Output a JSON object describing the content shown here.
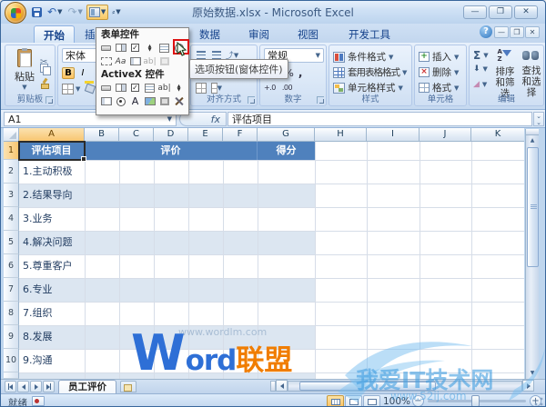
{
  "window": {
    "title": "原始数据.xlsx - Microsoft Excel",
    "qat_icons": [
      "office-button",
      "save",
      "undo",
      "redo",
      "insert-controls",
      "customize-quick-access"
    ],
    "window_controls": [
      "minimize",
      "restore",
      "close"
    ]
  },
  "ribbon": {
    "tabs": [
      {
        "label": "开始",
        "active": true
      },
      {
        "label": "插入",
        "active": false
      },
      {
        "label": "数据",
        "active": false
      },
      {
        "label": "审阅",
        "active": false
      },
      {
        "label": "视图",
        "active": false
      },
      {
        "label": "开发工具",
        "active": false
      }
    ],
    "clipboard": {
      "paste": "粘贴",
      "label": "剪贴板"
    },
    "font": {
      "name": "宋体",
      "bold": "B",
      "italic": "I"
    },
    "alignment": {
      "label": "对齐方式"
    },
    "number": {
      "format": "常规",
      "currency": "¥",
      "percent": "%",
      "comma": ",",
      "inc_decimal": "+.0",
      "dec_decimal": ".00",
      "label": "数字"
    },
    "styles": {
      "conditional": "条件格式",
      "format_table": "套用表格格式",
      "cell_styles": "单元格样式",
      "label": "样式"
    },
    "cells": {
      "insert": "插入",
      "delete": "删除",
      "format": "格式",
      "label": "单元格"
    },
    "editing": {
      "sum": "Σ",
      "sort": "排序和筛选",
      "find": "查找和选择",
      "label": "编辑"
    }
  },
  "controls_panel": {
    "form_header": "表单控件",
    "activex_header": "ActiveX 控件",
    "form_row1": [
      "button",
      "combo-box",
      "check-box",
      "spin-button",
      "list-box",
      "option-button"
    ],
    "form_row2": [
      "group-box",
      "label",
      "scroll-bar",
      "text-field",
      "shaded-area"
    ],
    "activex_row1": [
      "command-button",
      "combo-box",
      "check-box",
      "list-box",
      "text-box",
      "spin-button"
    ],
    "activex_row2": [
      "scroll-bar",
      "option-button",
      "label",
      "image",
      "toggle-button",
      "more-controls"
    ],
    "label_glyph": "Aa",
    "text_glyph": "ab|",
    "a_glyph": "A",
    "tooltip": "选项按钮(窗体控件)"
  },
  "formula_bar": {
    "name_box": "A1",
    "fx": "fx",
    "content": "评估项目"
  },
  "sheet": {
    "columns": [
      "A",
      "B",
      "C",
      "D",
      "E",
      "F",
      "G",
      "H",
      "I",
      "J",
      "K"
    ],
    "selected_cell": "A1",
    "header_row": {
      "a": "评估项目",
      "bf": "评价",
      "g": "得分"
    },
    "row_numbers": [
      "1",
      "2",
      "3",
      "4",
      "5",
      "6",
      "7",
      "8",
      "9",
      "10"
    ],
    "items": [
      "1.主动积极",
      "2.结果导向",
      "3.业务",
      "4.解决问题",
      "5.尊重客户",
      "6.专业",
      "7.组织",
      "8.发展",
      "9.沟通"
    ],
    "tab": "员工评价"
  },
  "status_bar": {
    "ready": "就绪",
    "zoom": "100%"
  },
  "watermark": {
    "center_word": "W",
    "center_ord": "ord",
    "center_lm": "联盟",
    "center_url": "www.wordlm.com",
    "corner_text": "我爱IT技术网",
    "corner_url": "www.52ij.com"
  },
  "colors": {
    "accent_header_blue": "#4f81bd",
    "band_blue": "#dce6f1",
    "selection_orange": "#f8c671",
    "watermark_orange": "#f07d01",
    "watermark_blue": "#2e6fd6"
  }
}
